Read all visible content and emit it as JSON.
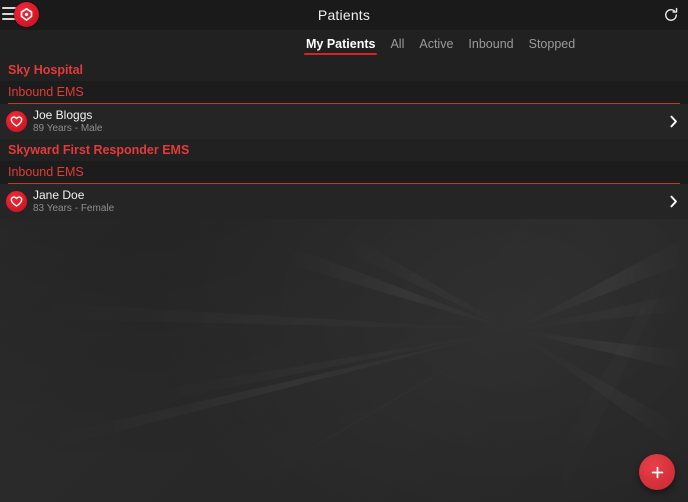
{
  "app": {
    "title": "Patients",
    "accent_color": "#e02020",
    "background_color": "#2a2a2a",
    "topbar_color": "#1a1a1a"
  },
  "topbar": {
    "menu_icon": "hamburger-icon",
    "logo_icon": "heart-shield-logo-icon",
    "title": "Patients",
    "refresh_icon": "refresh-icon"
  },
  "tabs": [
    {
      "label": "My Patients",
      "active": true
    },
    {
      "label": "All",
      "active": false
    },
    {
      "label": "Active",
      "active": false
    },
    {
      "label": "Inbound",
      "active": false
    },
    {
      "label": "Stopped",
      "active": false
    }
  ],
  "sections": [
    {
      "org": "Sky Hospital",
      "groups": [
        {
          "label": "Inbound EMS",
          "patients": [
            {
              "name": "Joe Bloggs",
              "meta": "89 Years - Male",
              "avatar_icon": "heart-icon",
              "chevron_icon": "chevron-right-icon"
            }
          ]
        }
      ]
    },
    {
      "org": "Skyward First Responder EMS",
      "groups": [
        {
          "label": "Inbound EMS",
          "patients": [
            {
              "name": "Jane Doe",
              "meta": "83 Years - Female",
              "avatar_icon": "heart-icon",
              "chevron_icon": "chevron-right-icon"
            }
          ]
        }
      ]
    }
  ],
  "fab": {
    "icon": "plus-icon",
    "label": "+"
  }
}
